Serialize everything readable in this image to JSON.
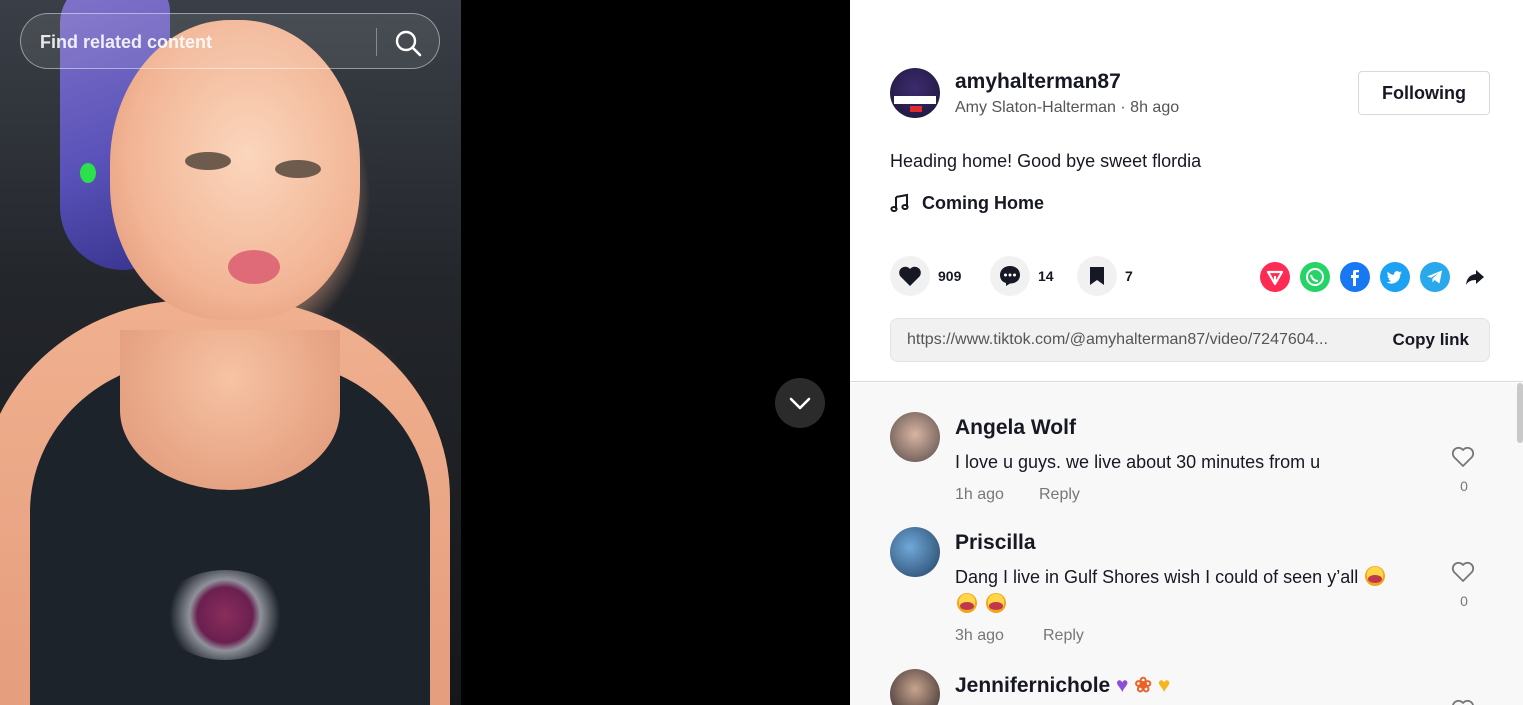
{
  "search": {
    "placeholder": "Find related content"
  },
  "author": {
    "username": "amyhalterman87",
    "display_name": "Amy Slaton-Halterman",
    "posted": "8h ago",
    "separator": " · "
  },
  "follow_button": {
    "label": "Following"
  },
  "video": {
    "caption": "Heading home! Good bye sweet flordia",
    "music": "Coming Home"
  },
  "actions": {
    "likes": "909",
    "comments": "14",
    "saves": "7"
  },
  "share_icons": [
    "repost-icon",
    "whatsapp-icon",
    "facebook-icon",
    "twitter-icon",
    "telegram-icon",
    "share-arrow-icon"
  ],
  "link": {
    "url": "https://www.tiktok.com/@amyhalterman87/video/7247604...",
    "copy_label": "Copy link"
  },
  "comments": [
    {
      "name": "Angela Wolf",
      "text": "I love u guys. we live about 30 minutes from u",
      "time": "1h ago",
      "reply": "Reply",
      "likes": "0"
    },
    {
      "name": "Priscilla",
      "text": "Dang I live in Gulf Shores wish I could of seen y’all",
      "time": "3h ago",
      "reply": "Reply",
      "likes": "0"
    },
    {
      "name": "Jennifernichole"
    }
  ],
  "colors": {
    "accent": "#fe2c55",
    "text": "#161823",
    "muted": "#777777"
  }
}
